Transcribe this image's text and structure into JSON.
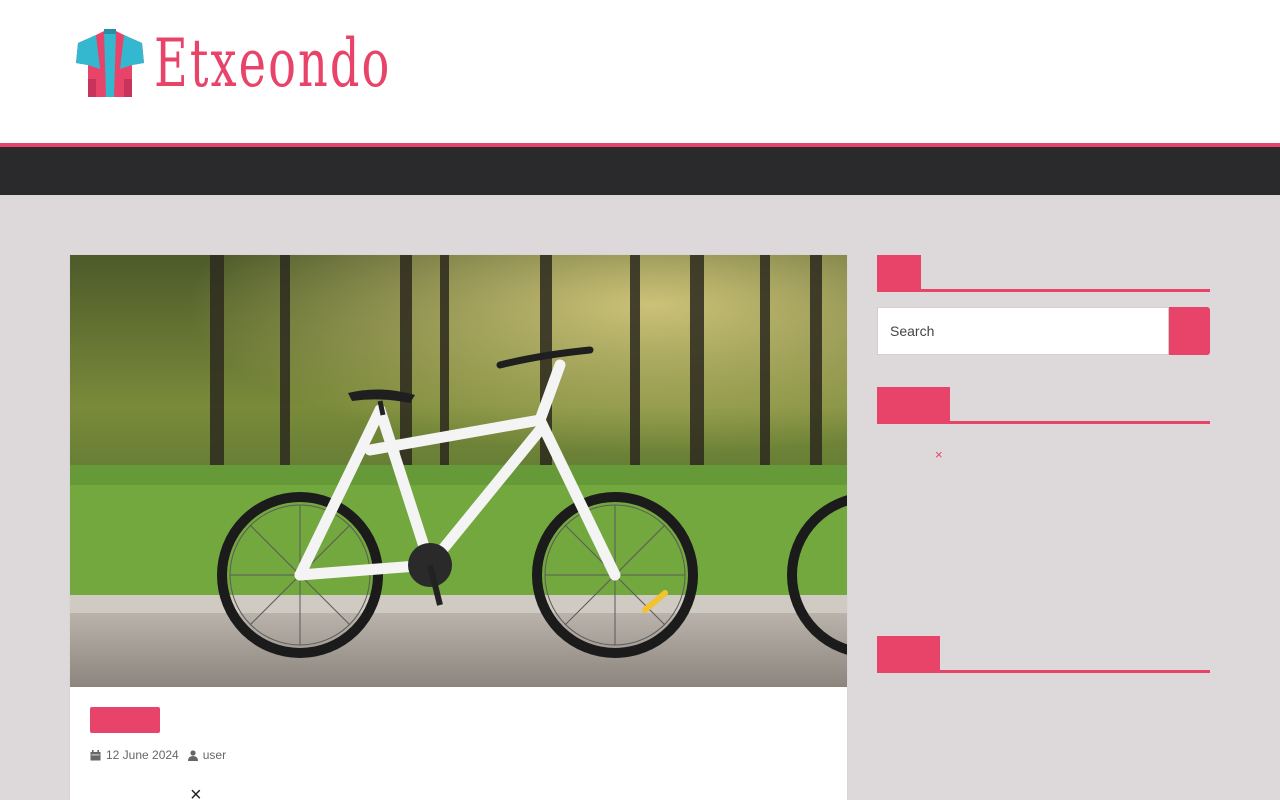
{
  "brand": {
    "name": "Etxeondo",
    "accent_color": "#e8446a",
    "nav_color": "#2a2a2d",
    "logo_icon": "jersey-logo-icon"
  },
  "post": {
    "image_alt": "White mountain bicycle parked on a path in a park",
    "date": "12 June 2024",
    "author": "user",
    "date_icon": "calendar-icon",
    "author_icon": "user-icon",
    "close_symbol": "×"
  },
  "sidebar": {
    "search": {
      "placeholder": "Search",
      "button_icon": "search-icon"
    },
    "close_symbol": "×"
  }
}
